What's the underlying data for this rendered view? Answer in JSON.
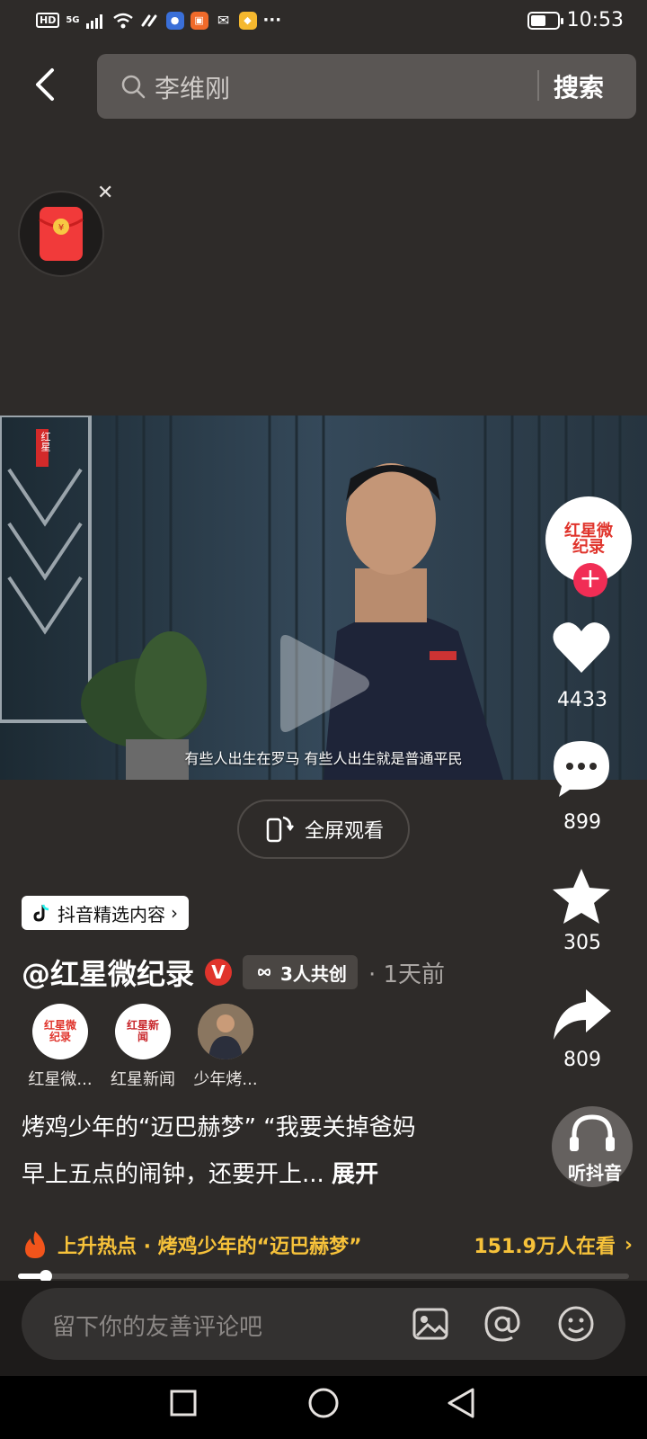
{
  "status_bar": {
    "network_badge": "HD",
    "network_type": "5G",
    "more": "···",
    "time": "10:53"
  },
  "search": {
    "query": "李维刚",
    "button_label": "搜索"
  },
  "video": {
    "watermark": "红星",
    "subtitle": "有些人出生在罗马 有些人出生就是普通平民",
    "fullscreen_label": "全屏观看"
  },
  "rail": {
    "author_avatar_text": "红星微纪录",
    "likes": "4433",
    "comments": "899",
    "favorites": "305",
    "shares": "809",
    "listen_label": "听抖音"
  },
  "post": {
    "featured_tag": "抖音精选内容",
    "author": "@红星微纪录",
    "cocreate_label": "3人共创",
    "time_ago": "· 1天前",
    "collaborators": [
      {
        "name": "红星微...",
        "logo": "红星微纪录"
      },
      {
        "name": "红星新闻",
        "logo": "红星新闻"
      },
      {
        "name": "少年烤..."
      }
    ],
    "description_line1": "烤鸡少年的“迈巴赫梦” “我要关掉爸妈",
    "description_line2": "早上五点的闹钟，还要开上...",
    "expand_label": "展开"
  },
  "hot_topic": {
    "label": "上升热点 · 烤鸡少年的“迈巴赫梦”",
    "viewers": "151.9万人在看"
  },
  "playback": {
    "progress": 0.045
  },
  "comment_bar": {
    "placeholder": "留下你的友善评论吧"
  },
  "colors": {
    "accent_red": "#f12d55",
    "hot_yellow": "#f7c23a",
    "brand_red": "#e0342c"
  }
}
